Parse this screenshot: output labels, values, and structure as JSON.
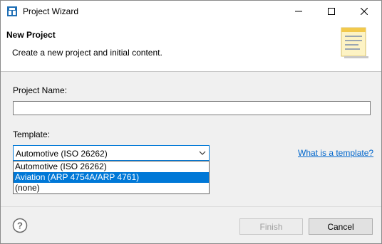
{
  "window": {
    "title": "Project Wizard"
  },
  "header": {
    "title": "New Project",
    "description": "Create a new project and initial content."
  },
  "form": {
    "project_name_label": "Project Name:",
    "project_name_value": "",
    "template_label": "Template:",
    "template_selected": "Automotive (ISO 26262)",
    "template_options": [
      "Automotive (ISO 26262)",
      "Aviation (ARP 4754A/ARP 4761)",
      "(none)"
    ],
    "highlighted_option_index": 1,
    "help_link": "What is a template?"
  },
  "footer": {
    "finish_label": "Finish",
    "cancel_label": "Cancel"
  },
  "colors": {
    "accent": "#0078d7",
    "link": "#0066cc"
  }
}
